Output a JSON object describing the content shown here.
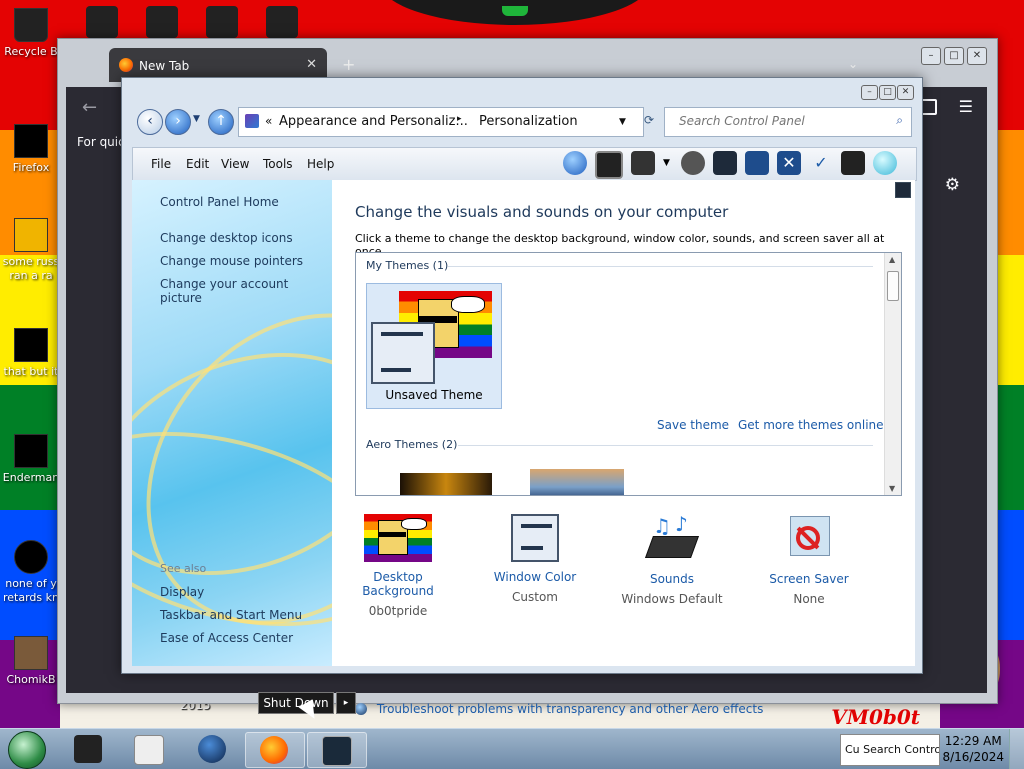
{
  "desktop": {
    "icons": [
      {
        "label": "Recycle B",
        "name": "recycle-bin-icon"
      },
      {
        "label": "Firefox",
        "name": "firefox-shortcut-icon"
      },
      {
        "label": "some russ\nran a ra",
        "name": "desktop-file-icon"
      },
      {
        "label": "that but it",
        "name": "desktop-file-icon"
      },
      {
        "label": "Enderman",
        "name": "desktop-file-icon"
      },
      {
        "label": "none of y\nretards kn",
        "name": "desktop-file-icon"
      },
      {
        "label": "ChomikB",
        "name": "desktop-file-icon"
      }
    ],
    "year_label": "2015",
    "watermark": "VM0b0t"
  },
  "firefox": {
    "tab_title": "New Tab",
    "quick_text": "For quick"
  },
  "control_panel": {
    "breadcrumb": {
      "prefix": "«",
      "parent": "Appearance and Personaliz...",
      "current": "Personalization"
    },
    "search_placeholder": "Search Control Panel",
    "menu": [
      "File",
      "Edit",
      "View",
      "Tools",
      "Help"
    ],
    "sidebar": {
      "home": "Control Panel Home",
      "links": [
        "Change desktop icons",
        "Change mouse pointers",
        "Change your account picture"
      ],
      "see_also_label": "See also",
      "see_also_links": [
        "Display",
        "Taskbar and Start Menu",
        "Ease of Access Center"
      ]
    },
    "main": {
      "heading": "Change the visuals and sounds on your computer",
      "subheading": "Click a theme to change the desktop background, window color, sounds, and screen saver all at once.",
      "my_themes_header": "My Themes (1)",
      "unsaved_theme": "Unsaved Theme",
      "save_theme": "Save theme",
      "get_more": "Get more themes online",
      "aero_themes_header": "Aero Themes (2)",
      "options": [
        {
          "title": "Desktop Background",
          "value": "0b0tpride"
        },
        {
          "title": "Window Color",
          "value": "Custom"
        },
        {
          "title": "Sounds",
          "value": "Windows Default"
        },
        {
          "title": "Screen Saver",
          "value": "None"
        }
      ],
      "troubleshoot": "Troubleshoot problems with transparency and other Aero effects"
    }
  },
  "start_menu": {
    "shutdown_label": "Shut Down",
    "arrow": "▸"
  },
  "taskbar": {
    "tray_text": "Cu Search Contro",
    "time": "12:29 AM",
    "date": "8/16/2024"
  }
}
